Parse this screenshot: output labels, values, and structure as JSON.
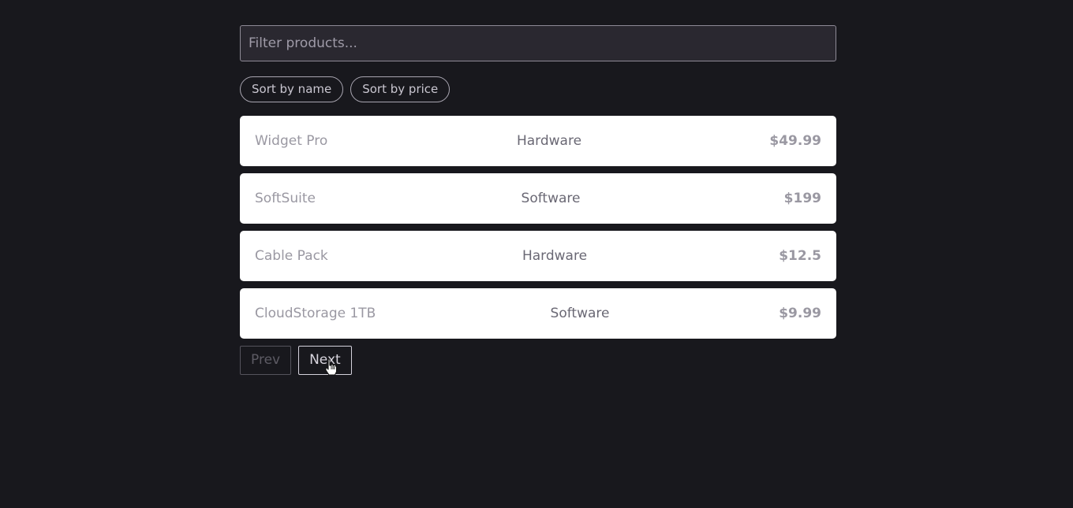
{
  "filter": {
    "placeholder": "Filter products...",
    "value": ""
  },
  "sort": {
    "by_name_label": "Sort by name",
    "by_price_label": "Sort by price"
  },
  "products": [
    {
      "name": "Widget Pro",
      "category": "Hardware",
      "price": "$49.99"
    },
    {
      "name": "SoftSuite",
      "category": "Software",
      "price": "$199"
    },
    {
      "name": "Cable Pack",
      "category": "Hardware",
      "price": "$12.5"
    },
    {
      "name": "CloudStorage 1TB",
      "category": "Software",
      "price": "$9.99"
    }
  ],
  "pager": {
    "prev_label": "Prev",
    "next_label": "Next",
    "prev_disabled": true
  },
  "colors": {
    "page_background": "#18181d",
    "card_background": "#ffffff"
  },
  "icons": {
    "cursor": "hand-pointer-icon"
  }
}
